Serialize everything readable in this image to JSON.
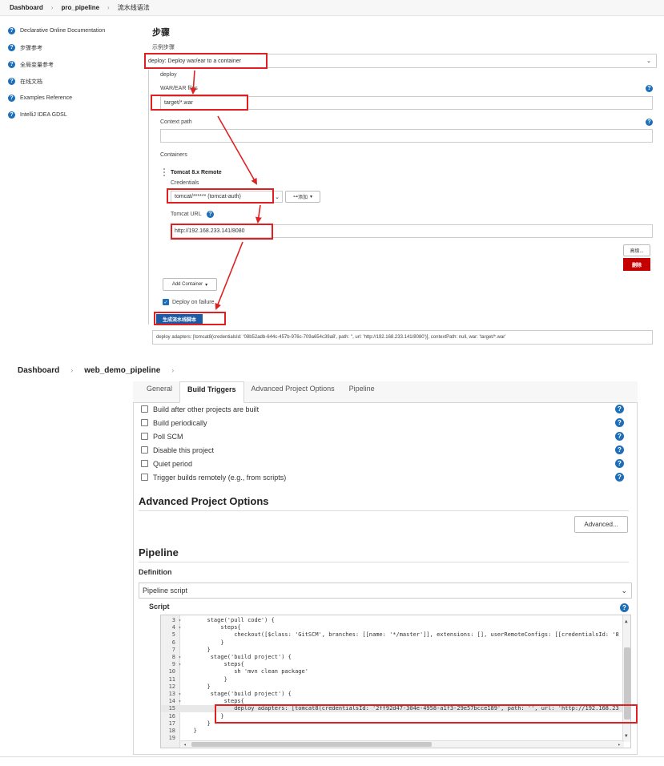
{
  "top": {
    "breadcrumb": {
      "home": "Dashboard",
      "job": "pro_pipeline",
      "page": "流水线语法"
    },
    "sidebar": [
      {
        "label": "Declarative Online Documentation"
      },
      {
        "label": "步骤参考"
      },
      {
        "label": "全局变量参考"
      },
      {
        "label": "在线文档"
      },
      {
        "label": "Examples Reference"
      },
      {
        "label": "IntelliJ IDEA GDSL"
      }
    ],
    "steps_title": "步骤",
    "sample_step_label": "示例步骤",
    "sample_step_value": "deploy: Deploy war/ear to a container",
    "deploy_label": "deploy",
    "war_label": "WAR/EAR files",
    "war_value": "target/*.war",
    "context_label": "Context path",
    "context_value": "",
    "containers_label": "Containers",
    "tomcat_title": "Tomcat 8.x Remote",
    "credentials_label": "Credentials",
    "credentials_value": "tomcat/****** (tomcat-auth)",
    "add_cred_label": "添加",
    "tomcat_url_label": "Tomcat URL",
    "tomcat_url_value": "http://192.168.233.141/8080",
    "advanced_label": "高级...",
    "delete_label": "删除",
    "add_container_label": "Add Container",
    "deploy_failure_label": "Deploy on failure",
    "generate_label": "生成流水线脚本",
    "output": "deploy adapters: [tomcat8(credentialsId: '08b52adb-644c-457b-976c-709a654c39a8', path: '', url: 'http://192.168.233.141/8080')], contextPath: null, war: 'target/*.war'"
  },
  "bottom": {
    "breadcrumb": {
      "home": "Dashboard",
      "job": "web_demo_pipeline"
    },
    "tabs": [
      "General",
      "Build Triggers",
      "Advanced Project Options",
      "Pipeline"
    ],
    "triggers": [
      "Build after other projects are built",
      "Build periodically",
      "Poll SCM",
      "Disable this project",
      "Quiet period",
      "Trigger builds remotely (e.g., from scripts)"
    ],
    "advanced_title": "Advanced Project Options",
    "advanced_button": "Advanced...",
    "pipeline_title": "Pipeline",
    "definition_label": "Definition",
    "definition_value": "Pipeline script",
    "script_label": "Script",
    "code": [
      {
        "n": "3",
        "f": "▾",
        "t": "    stage('pull code') {"
      },
      {
        "n": "4",
        "f": "▾",
        "t": "        steps{"
      },
      {
        "n": "5",
        "f": "",
        "t": "            checkout([$class: 'GitSCM', branches: [[name: '*/master']], extensions: [], userRemoteConfigs: [[credentialsId: '8"
      },
      {
        "n": "6",
        "f": "",
        "t": "        }"
      },
      {
        "n": "7",
        "f": "",
        "t": "    }"
      },
      {
        "n": "8",
        "f": "▾",
        "t": "     stage('build project') {"
      },
      {
        "n": "9",
        "f": "▾",
        "t": "         steps{"
      },
      {
        "n": "10",
        "f": "",
        "t": "            sh 'mvn clean package'"
      },
      {
        "n": "11",
        "f": "",
        "t": "         }"
      },
      {
        "n": "12",
        "f": "",
        "t": "    }"
      },
      {
        "n": "13",
        "f": "▾",
        "t": "     stage('build project') {"
      },
      {
        "n": "14",
        "f": "▾",
        "t": "         steps{"
      },
      {
        "n": "15",
        "f": "",
        "t": "            deploy adapters: [tomcat8(credentialsId: '2ff92d47-304e-4958-a1f3-29e57bcce189', path: '', url: 'http://192.168.23"
      },
      {
        "n": "16",
        "f": "",
        "t": "        }"
      },
      {
        "n": "17",
        "f": "",
        "t": "    }"
      },
      {
        "n": "18",
        "f": "",
        "t": "}"
      },
      {
        "n": "19",
        "f": "",
        "t": ""
      }
    ]
  }
}
